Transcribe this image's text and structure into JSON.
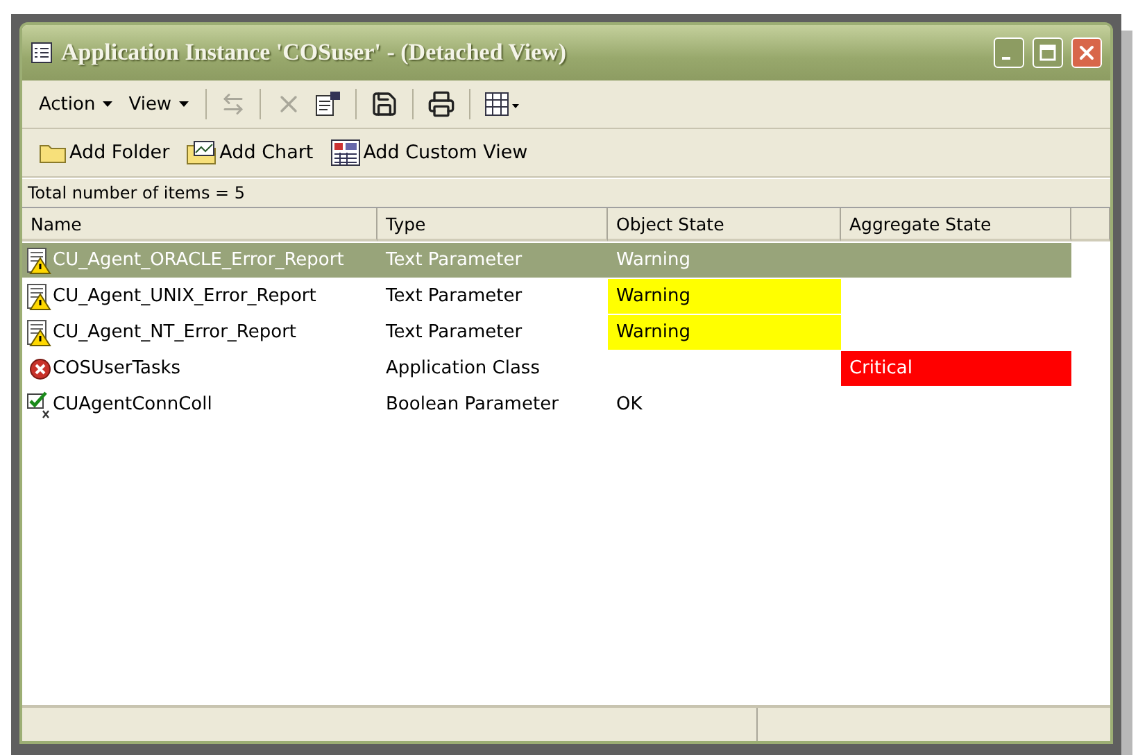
{
  "window": {
    "title": "Application Instance 'COSuser' - (Detached View)"
  },
  "toolbar": {
    "menus": [
      "Action",
      "View"
    ]
  },
  "actions": [
    {
      "kind": "folder",
      "label": "Add Folder"
    },
    {
      "kind": "chart",
      "label": "Add Chart"
    },
    {
      "kind": "custom",
      "label": "Add Custom View"
    }
  ],
  "summary": "Total number of items = 5",
  "table": {
    "columns": [
      "Name",
      "Type",
      "Object State",
      "Aggregate State"
    ],
    "rows": [
      {
        "kind": "warning",
        "selected": true,
        "name": "CU_Agent_ORACLE_Error_Report",
        "type": "Text Parameter",
        "object_state": {
          "text": "Warning"
        },
        "aggregate_state": {}
      },
      {
        "kind": "warning",
        "selected": false,
        "name": "CU_Agent_UNIX_Error_Report",
        "type": "Text Parameter",
        "object_state": {
          "text": "Warning",
          "color": "#ffff00"
        },
        "aggregate_state": {}
      },
      {
        "kind": "warning",
        "selected": false,
        "name": "CU_Agent_NT_Error_Report",
        "type": "Text Parameter",
        "object_state": {
          "text": "Warning",
          "color": "#ffff00"
        },
        "aggregate_state": {}
      },
      {
        "kind": "error",
        "selected": false,
        "name": "COSUserTasks",
        "type": "Application Class",
        "object_state": {},
        "aggregate_state": {
          "text": "Critical",
          "color": "#ff0000"
        }
      },
      {
        "kind": "ok",
        "selected": false,
        "name": "CUAgentConnColl",
        "type": "Boolean Parameter",
        "object_state": {
          "text": "OK"
        },
        "aggregate_state": {}
      }
    ]
  }
}
